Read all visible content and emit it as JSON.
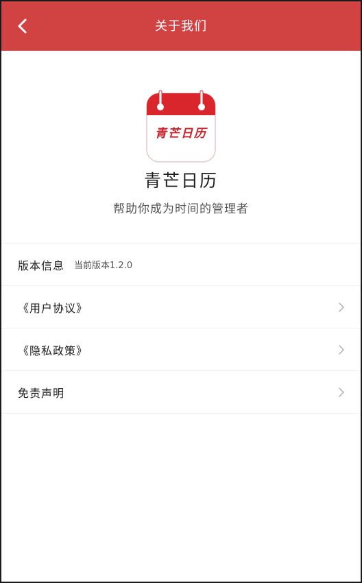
{
  "header": {
    "title": "关于我们",
    "back_icon": "chevron-left-icon",
    "background_color": "#d14343"
  },
  "app": {
    "logo_icon": "calendar-icon",
    "logo_text": "青芒日历",
    "name": "青芒日历",
    "slogan": "帮助你成为时间的管理者"
  },
  "list": {
    "version": {
      "label": "版本信息",
      "value": "当前版本1.2.0"
    },
    "user_agreement": {
      "label": "《用户协议》",
      "icon": "chevron-right-icon"
    },
    "privacy_policy": {
      "label": "《隐私政策》",
      "icon": "chevron-right-icon"
    },
    "disclaimer": {
      "label": "免责声明",
      "icon": "chevron-right-icon"
    }
  }
}
